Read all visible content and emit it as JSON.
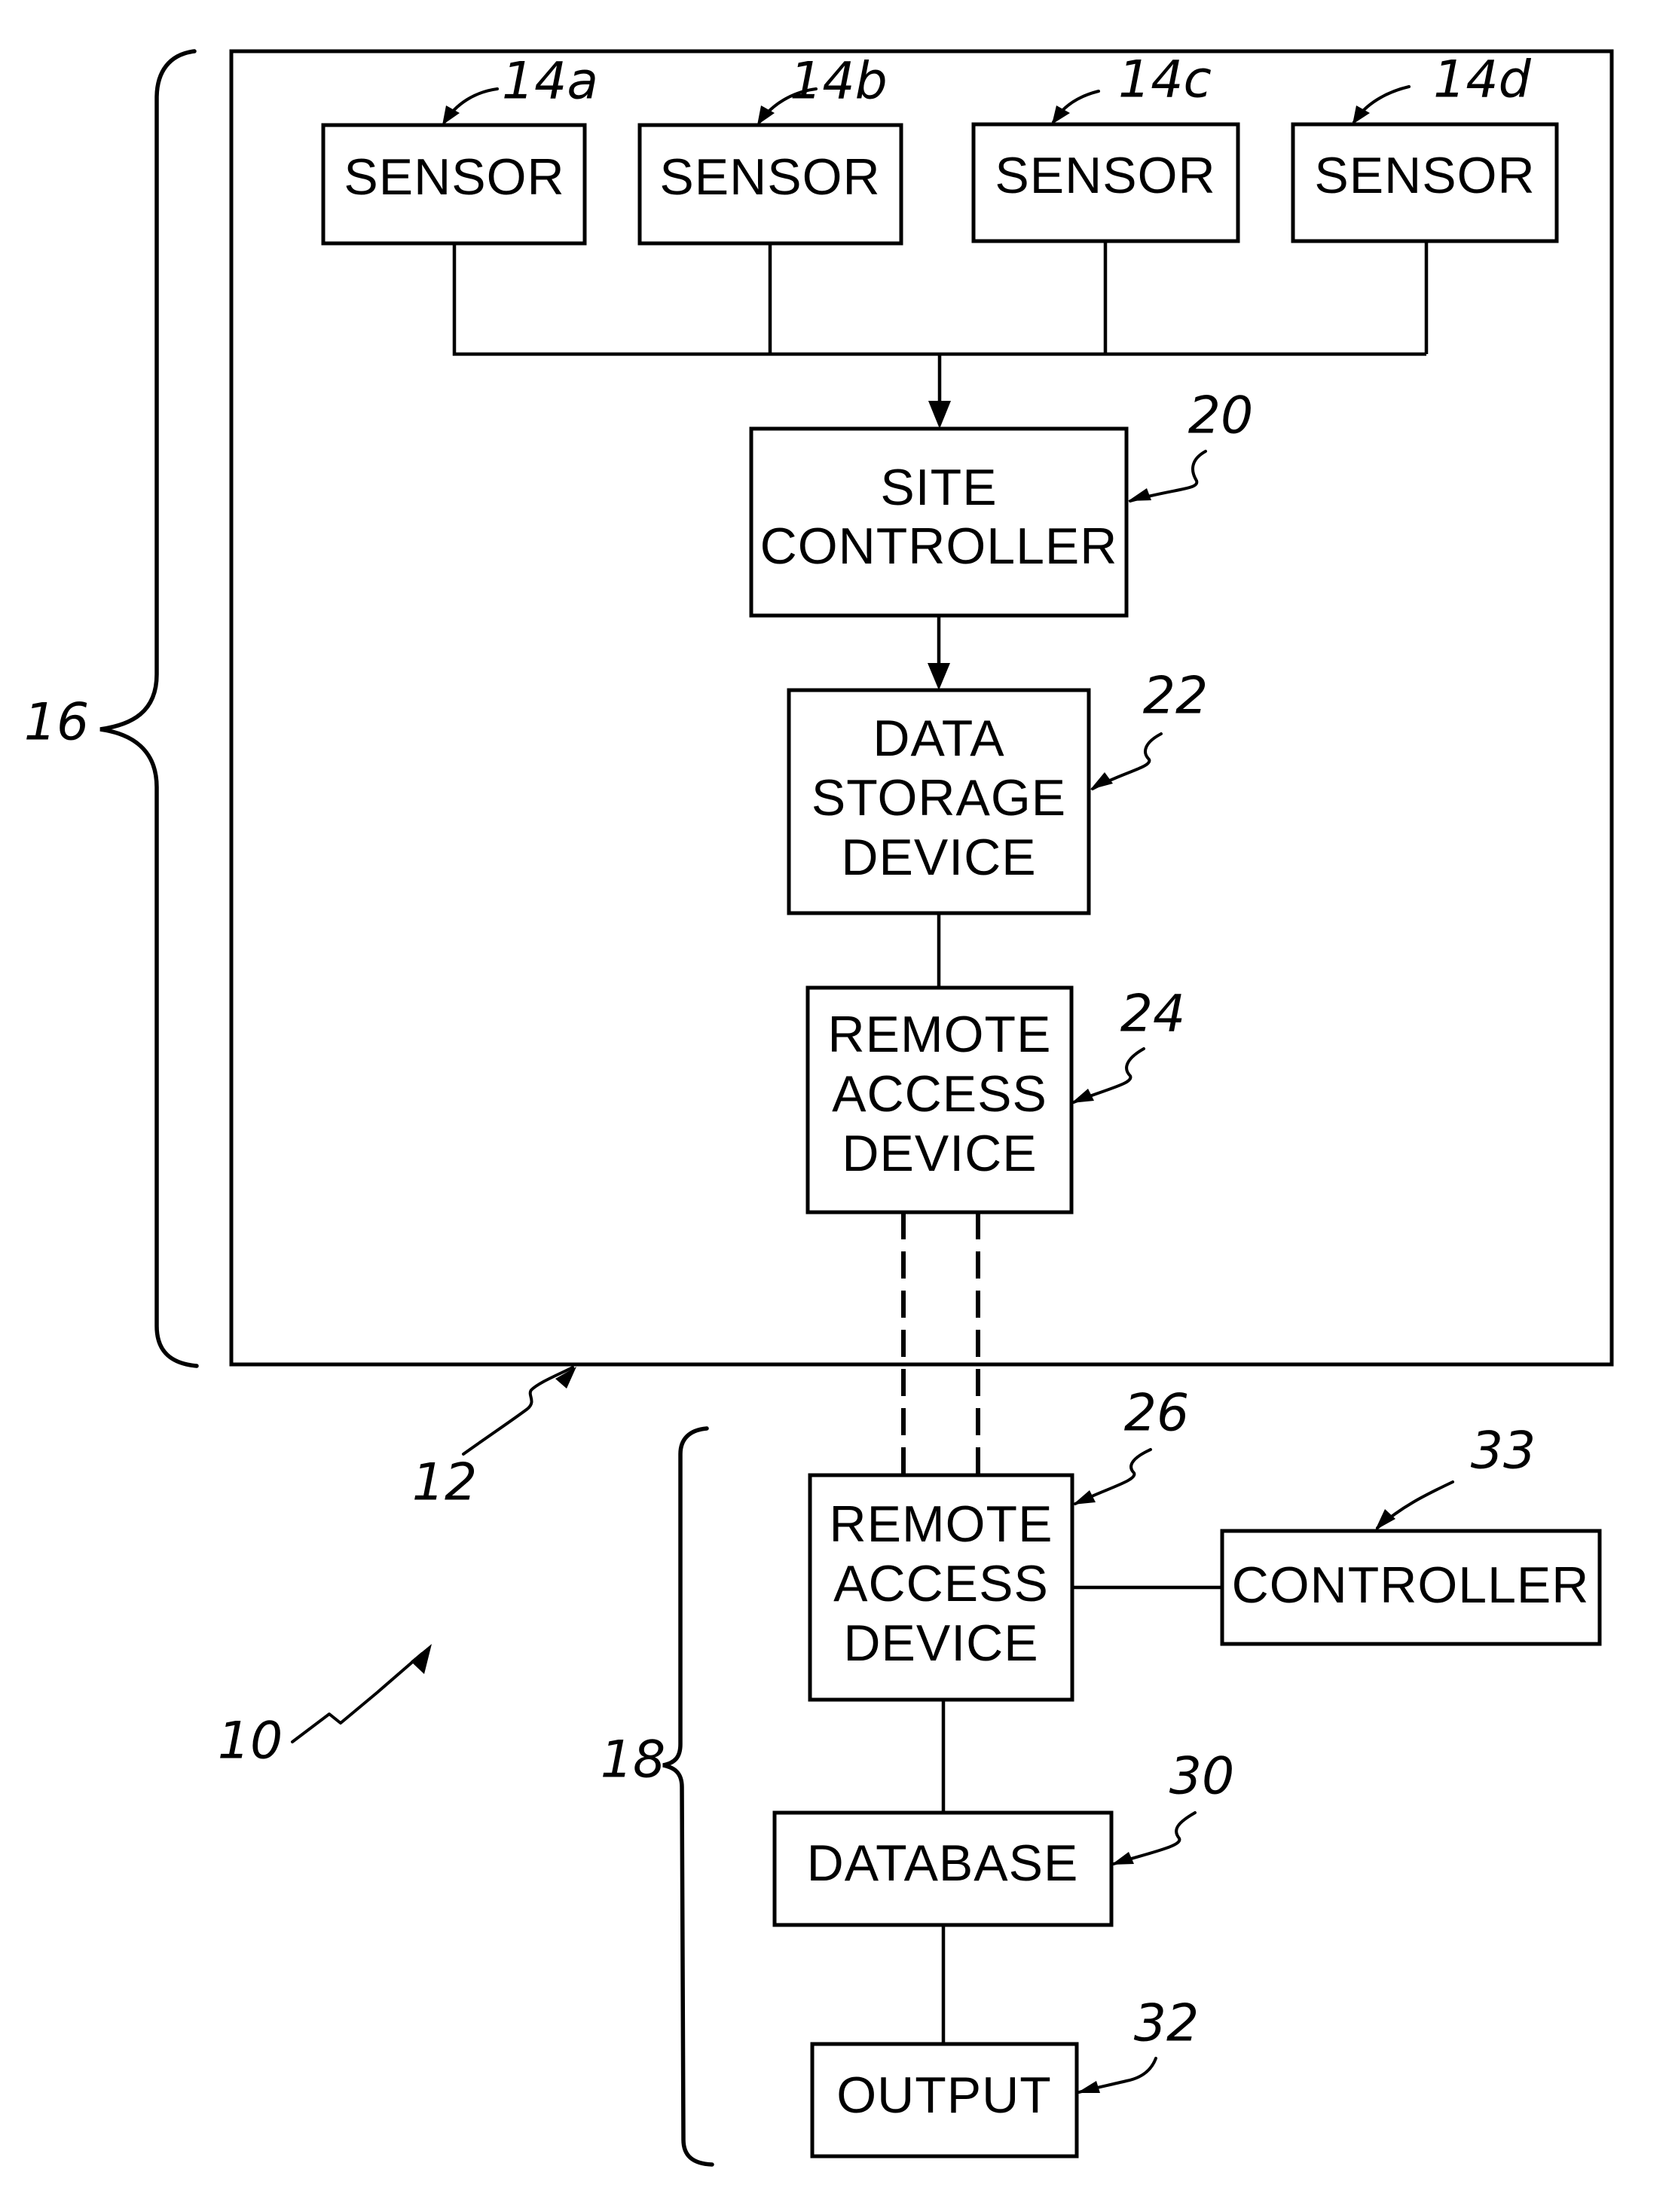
{
  "figure": {
    "system_ref": "10",
    "site": {
      "ref": "12",
      "group_ref": "16",
      "sensors": [
        {
          "ref": "14a",
          "label": "SENSOR"
        },
        {
          "ref": "14b",
          "label": "SENSOR"
        },
        {
          "ref": "14c",
          "label": "SENSOR"
        },
        {
          "ref": "14d",
          "label": "SENSOR"
        }
      ],
      "site_controller": {
        "ref": "20",
        "lines": [
          "SITE",
          "CONTROLLER"
        ]
      },
      "data_storage": {
        "ref": "22",
        "lines": [
          "DATA",
          "STORAGE",
          "DEVICE"
        ]
      },
      "remote_access": {
        "ref": "24",
        "lines": [
          "REMOTE",
          "ACCESS",
          "DEVICE"
        ]
      }
    },
    "central": {
      "group_ref": "18",
      "remote_access": {
        "ref": "26",
        "lines": [
          "REMOTE",
          "ACCESS",
          "DEVICE"
        ]
      },
      "controller": {
        "ref": "33",
        "label": "CONTROLLER"
      },
      "database": {
        "ref": "30",
        "label": "DATABASE"
      },
      "output": {
        "ref": "32",
        "label": "OUTPUT"
      }
    }
  }
}
